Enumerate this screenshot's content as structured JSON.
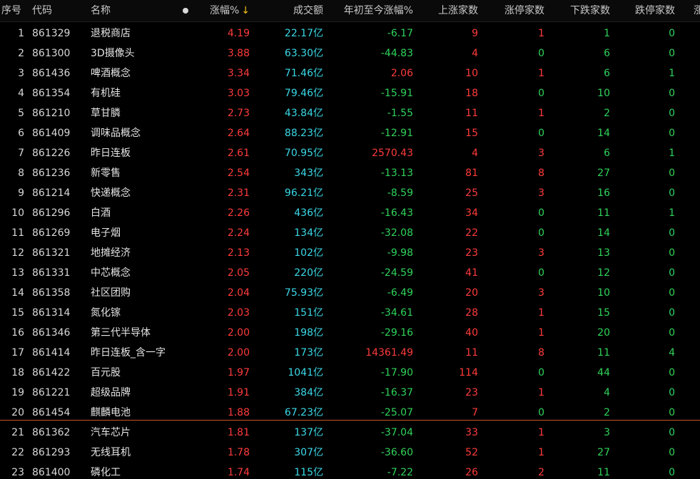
{
  "colors": {
    "up": "#ff3b3b",
    "down": "#2fd35a",
    "volume": "#3ad8e6",
    "divider": "#c2532d",
    "sort_arrow": "#f2c314"
  },
  "header": {
    "index": "序号",
    "code": "代码",
    "name": "名称",
    "change_pct": "涨幅%",
    "sort_icon": "sort-down-arrow-icon",
    "volume": "成交额",
    "ytd_pct": "年初至今涨幅%",
    "up_count": "上涨家数",
    "limit_up_count": "涨停家数",
    "down_count": "下跌家数",
    "limit_down_count": "跌停家数",
    "more": "涨"
  },
  "rows": [
    {
      "idx": "1",
      "code": "861329",
      "name": "退税商店",
      "chg": "4.19",
      "vol": "22.17亿",
      "ytd": "-6.17",
      "up": "9",
      "lu": "1",
      "dn": "1",
      "ld": "0"
    },
    {
      "idx": "2",
      "code": "861300",
      "name": "3D摄像头",
      "chg": "3.88",
      "vol": "63.30亿",
      "ytd": "-44.83",
      "up": "4",
      "lu": "0",
      "dn": "6",
      "ld": "0"
    },
    {
      "idx": "3",
      "code": "861436",
      "name": "啤酒概念",
      "chg": "3.34",
      "vol": "71.46亿",
      "ytd": "2.06",
      "up": "10",
      "lu": "1",
      "dn": "6",
      "ld": "1"
    },
    {
      "idx": "4",
      "code": "861354",
      "name": "有机硅",
      "chg": "3.03",
      "vol": "79.46亿",
      "ytd": "-15.91",
      "up": "18",
      "lu": "0",
      "dn": "10",
      "ld": "0"
    },
    {
      "idx": "5",
      "code": "861210",
      "name": "草甘膦",
      "chg": "2.73",
      "vol": "43.84亿",
      "ytd": "-1.55",
      "up": "11",
      "lu": "1",
      "dn": "2",
      "ld": "0"
    },
    {
      "idx": "6",
      "code": "861409",
      "name": "调味品概念",
      "chg": "2.64",
      "vol": "88.23亿",
      "ytd": "-12.91",
      "up": "15",
      "lu": "0",
      "dn": "14",
      "ld": "0"
    },
    {
      "idx": "7",
      "code": "861226",
      "name": "昨日连板",
      "chg": "2.61",
      "vol": "70.95亿",
      "ytd": "2570.43",
      "up": "4",
      "lu": "3",
      "dn": "6",
      "ld": "1"
    },
    {
      "idx": "8",
      "code": "861236",
      "name": "新零售",
      "chg": "2.54",
      "vol": "343亿",
      "ytd": "-13.13",
      "up": "81",
      "lu": "8",
      "dn": "27",
      "ld": "0"
    },
    {
      "idx": "9",
      "code": "861214",
      "name": "快递概念",
      "chg": "2.31",
      "vol": "96.21亿",
      "ytd": "-8.59",
      "up": "25",
      "lu": "3",
      "dn": "16",
      "ld": "0"
    },
    {
      "idx": "10",
      "code": "861296",
      "name": "白酒",
      "chg": "2.26",
      "vol": "436亿",
      "ytd": "-16.43",
      "up": "34",
      "lu": "0",
      "dn": "11",
      "ld": "1"
    },
    {
      "idx": "11",
      "code": "861269",
      "name": "电子烟",
      "chg": "2.24",
      "vol": "134亿",
      "ytd": "-32.08",
      "up": "22",
      "lu": "0",
      "dn": "14",
      "ld": "0"
    },
    {
      "idx": "12",
      "code": "861321",
      "name": "地摊经济",
      "chg": "2.13",
      "vol": "102亿",
      "ytd": "-9.98",
      "up": "23",
      "lu": "3",
      "dn": "13",
      "ld": "0"
    },
    {
      "idx": "13",
      "code": "861331",
      "name": "中芯概念",
      "chg": "2.05",
      "vol": "220亿",
      "ytd": "-24.59",
      "up": "41",
      "lu": "0",
      "dn": "12",
      "ld": "0"
    },
    {
      "idx": "14",
      "code": "861358",
      "name": "社区团购",
      "chg": "2.04",
      "vol": "75.93亿",
      "ytd": "-6.49",
      "up": "20",
      "lu": "3",
      "dn": "10",
      "ld": "0"
    },
    {
      "idx": "15",
      "code": "861314",
      "name": "氮化镓",
      "chg": "2.03",
      "vol": "151亿",
      "ytd": "-34.61",
      "up": "28",
      "lu": "1",
      "dn": "15",
      "ld": "0"
    },
    {
      "idx": "16",
      "code": "861346",
      "name": "第三代半导体",
      "chg": "2.00",
      "vol": "198亿",
      "ytd": "-29.16",
      "up": "40",
      "lu": "1",
      "dn": "20",
      "ld": "0"
    },
    {
      "idx": "17",
      "code": "861414",
      "name": "昨日连板_含一字",
      "chg": "2.00",
      "vol": "173亿",
      "ytd": "14361.49",
      "up": "11",
      "lu": "8",
      "dn": "11",
      "ld": "4"
    },
    {
      "idx": "18",
      "code": "861422",
      "name": "百元股",
      "chg": "1.97",
      "vol": "1041亿",
      "ytd": "-17.90",
      "up": "114",
      "lu": "0",
      "dn": "44",
      "ld": "0"
    },
    {
      "idx": "19",
      "code": "861221",
      "name": "超级品牌",
      "chg": "1.91",
      "vol": "384亿",
      "ytd": "-16.37",
      "up": "23",
      "lu": "1",
      "dn": "4",
      "ld": "0"
    },
    {
      "idx": "20",
      "code": "861454",
      "name": "麒麟电池",
      "chg": "1.88",
      "vol": "67.23亿",
      "ytd": "-25.07",
      "up": "7",
      "lu": "0",
      "dn": "2",
      "ld": "0"
    },
    {
      "idx": "21",
      "code": "861362",
      "name": "汽车芯片",
      "chg": "1.81",
      "vol": "137亿",
      "ytd": "-37.04",
      "up": "33",
      "lu": "1",
      "dn": "3",
      "ld": "0"
    },
    {
      "idx": "22",
      "code": "861293",
      "name": "无线耳机",
      "chg": "1.78",
      "vol": "307亿",
      "ytd": "-36.60",
      "up": "52",
      "lu": "1",
      "dn": "27",
      "ld": "0"
    },
    {
      "idx": "23",
      "code": "861400",
      "name": "磷化工",
      "chg": "1.74",
      "vol": "115亿",
      "ytd": "-7.22",
      "up": "26",
      "lu": "2",
      "dn": "11",
      "ld": "0"
    }
  ]
}
